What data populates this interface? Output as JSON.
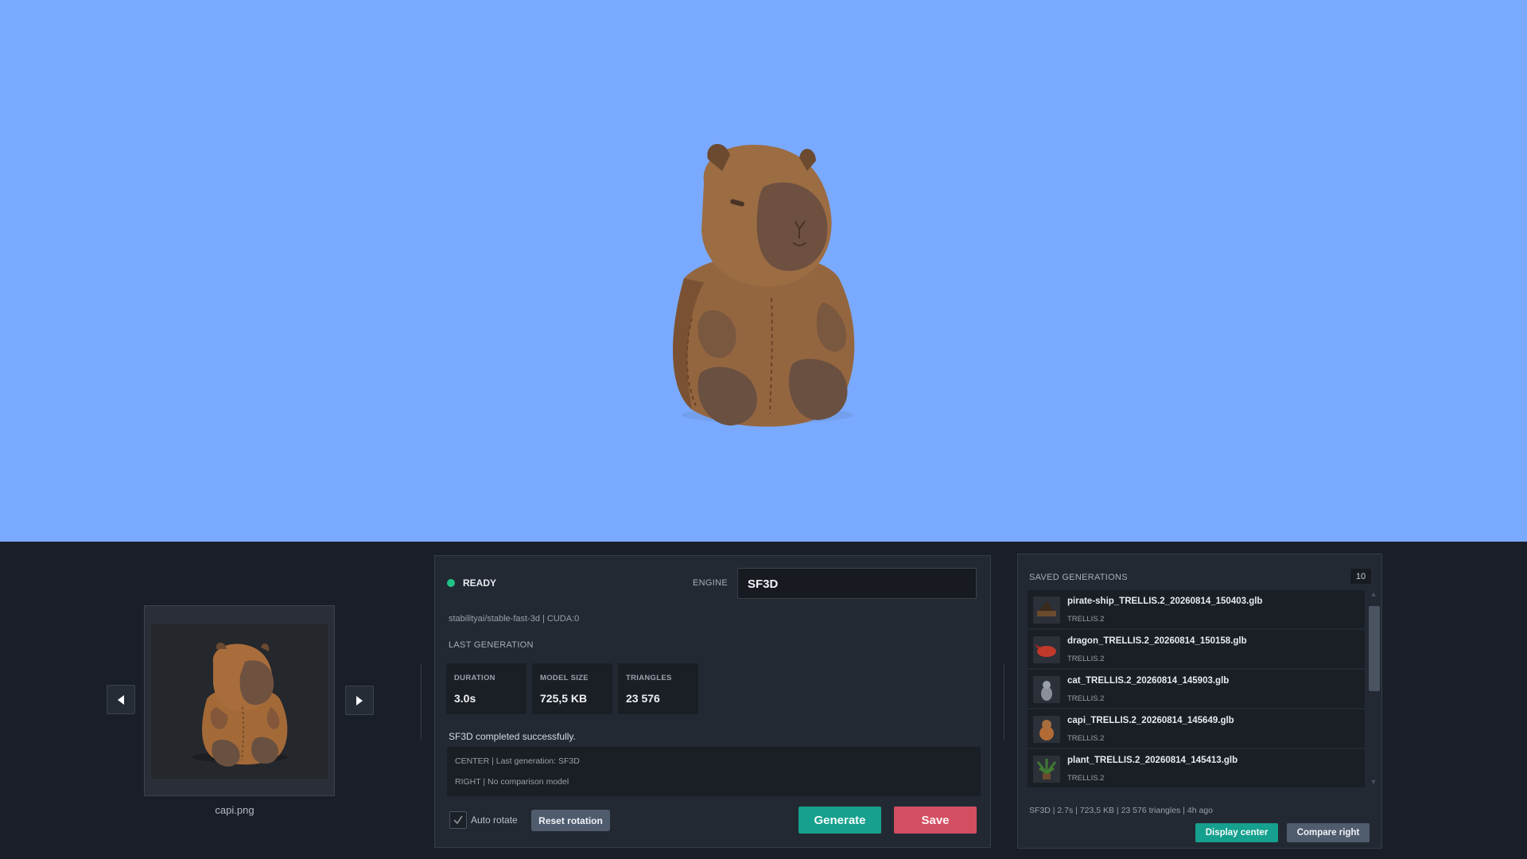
{
  "viewport": {
    "background": "#7aaaff",
    "model_name": "capybara-3d-model"
  },
  "preview": {
    "filename": "capi.png"
  },
  "status": {
    "label": "READY",
    "color": "#21c285"
  },
  "engine": {
    "label": "ENGINE",
    "value": "SF3D"
  },
  "model_info": "stabilityai/stable-fast-3d  |  CUDA:0",
  "last_generation": {
    "title": "LAST GENERATION",
    "duration": {
      "label": "DURATION",
      "value": "3.0s"
    },
    "model_size": {
      "label": "MODEL SIZE",
      "value": "725,5 KB"
    },
    "triangles": {
      "label": "TRIANGLES",
      "value": "23 576"
    }
  },
  "result_message": "SF3D completed successfully.",
  "log": {
    "line1": "CENTER | Last generation: SF3D",
    "line2": "RIGHT | No comparison model"
  },
  "controls": {
    "auto_rotate_label": "Auto rotate",
    "auto_rotate_checked": true,
    "reset_label": "Reset rotation",
    "generate_label": "Generate",
    "save_label": "Save"
  },
  "saved": {
    "title": "SAVED GENERATIONS",
    "count": "10",
    "items": [
      {
        "filename": "pirate-ship_TRELLIS.2_20260814_150403.glb",
        "engine": "TRELLIS.2",
        "thumb_color": "#6b4a2e"
      },
      {
        "filename": "dragon_TRELLIS.2_20260814_150158.glb",
        "engine": "TRELLIS.2",
        "thumb_color": "#c0392b"
      },
      {
        "filename": "cat_TRELLIS.2_20260814_145903.glb",
        "engine": "TRELLIS.2",
        "thumb_color": "#8a8f99"
      },
      {
        "filename": "capi_TRELLIS.2_20260814_145649.glb",
        "engine": "TRELLIS.2",
        "thumb_color": "#b36b35"
      },
      {
        "filename": "plant_TRELLIS.2_20260814_145413.glb",
        "engine": "TRELLIS.2",
        "thumb_color": "#3f7a34"
      }
    ],
    "meta": "SF3D | 2.7s | 723,5 KB | 23 576 triangles | 4h ago",
    "display_center_label": "Display center",
    "compare_right_label": "Compare right"
  }
}
